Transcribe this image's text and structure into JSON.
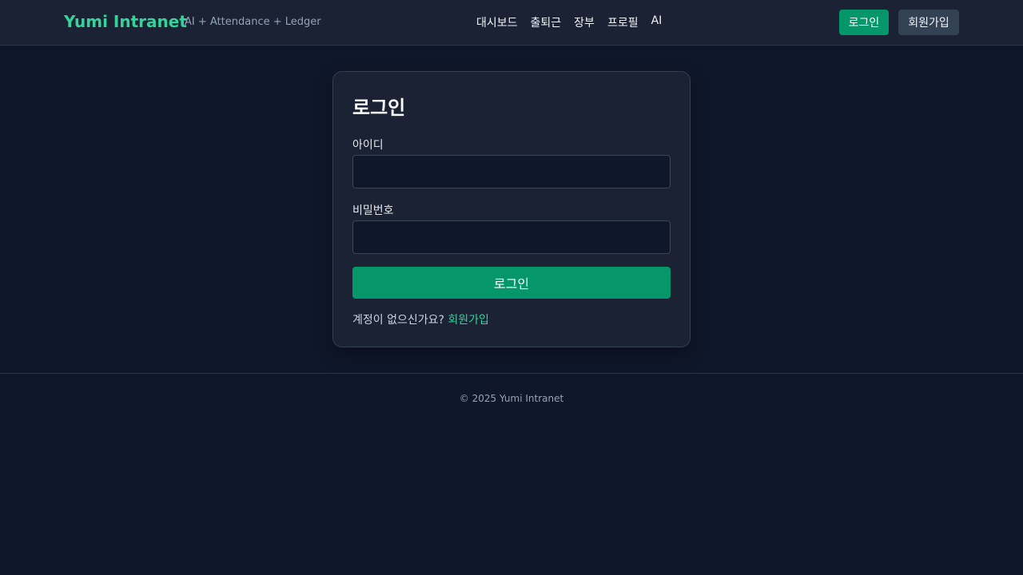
{
  "header": {
    "brand": "Yumi Intranet",
    "tagline": "AI + Attendance + Ledger",
    "nav": [
      "대시보드",
      "출퇴근",
      "장부",
      "프로필",
      "AI"
    ],
    "login_label": "로그인",
    "signup_label": "회원가입"
  },
  "login_form": {
    "title": "로그인",
    "username_label": "아이디",
    "username_value": "",
    "password_label": "비밀번호",
    "password_value": "",
    "submit_label": "로그인",
    "no_account_text": "계정이 없으신가요?",
    "signup_link": "회원가입"
  },
  "footer": {
    "copyright": "© 2025 Yumi Intranet"
  },
  "colors": {
    "background": "#0f172a",
    "surface": "#1a2233",
    "accent": "#059669",
    "brand": "#34d399"
  }
}
